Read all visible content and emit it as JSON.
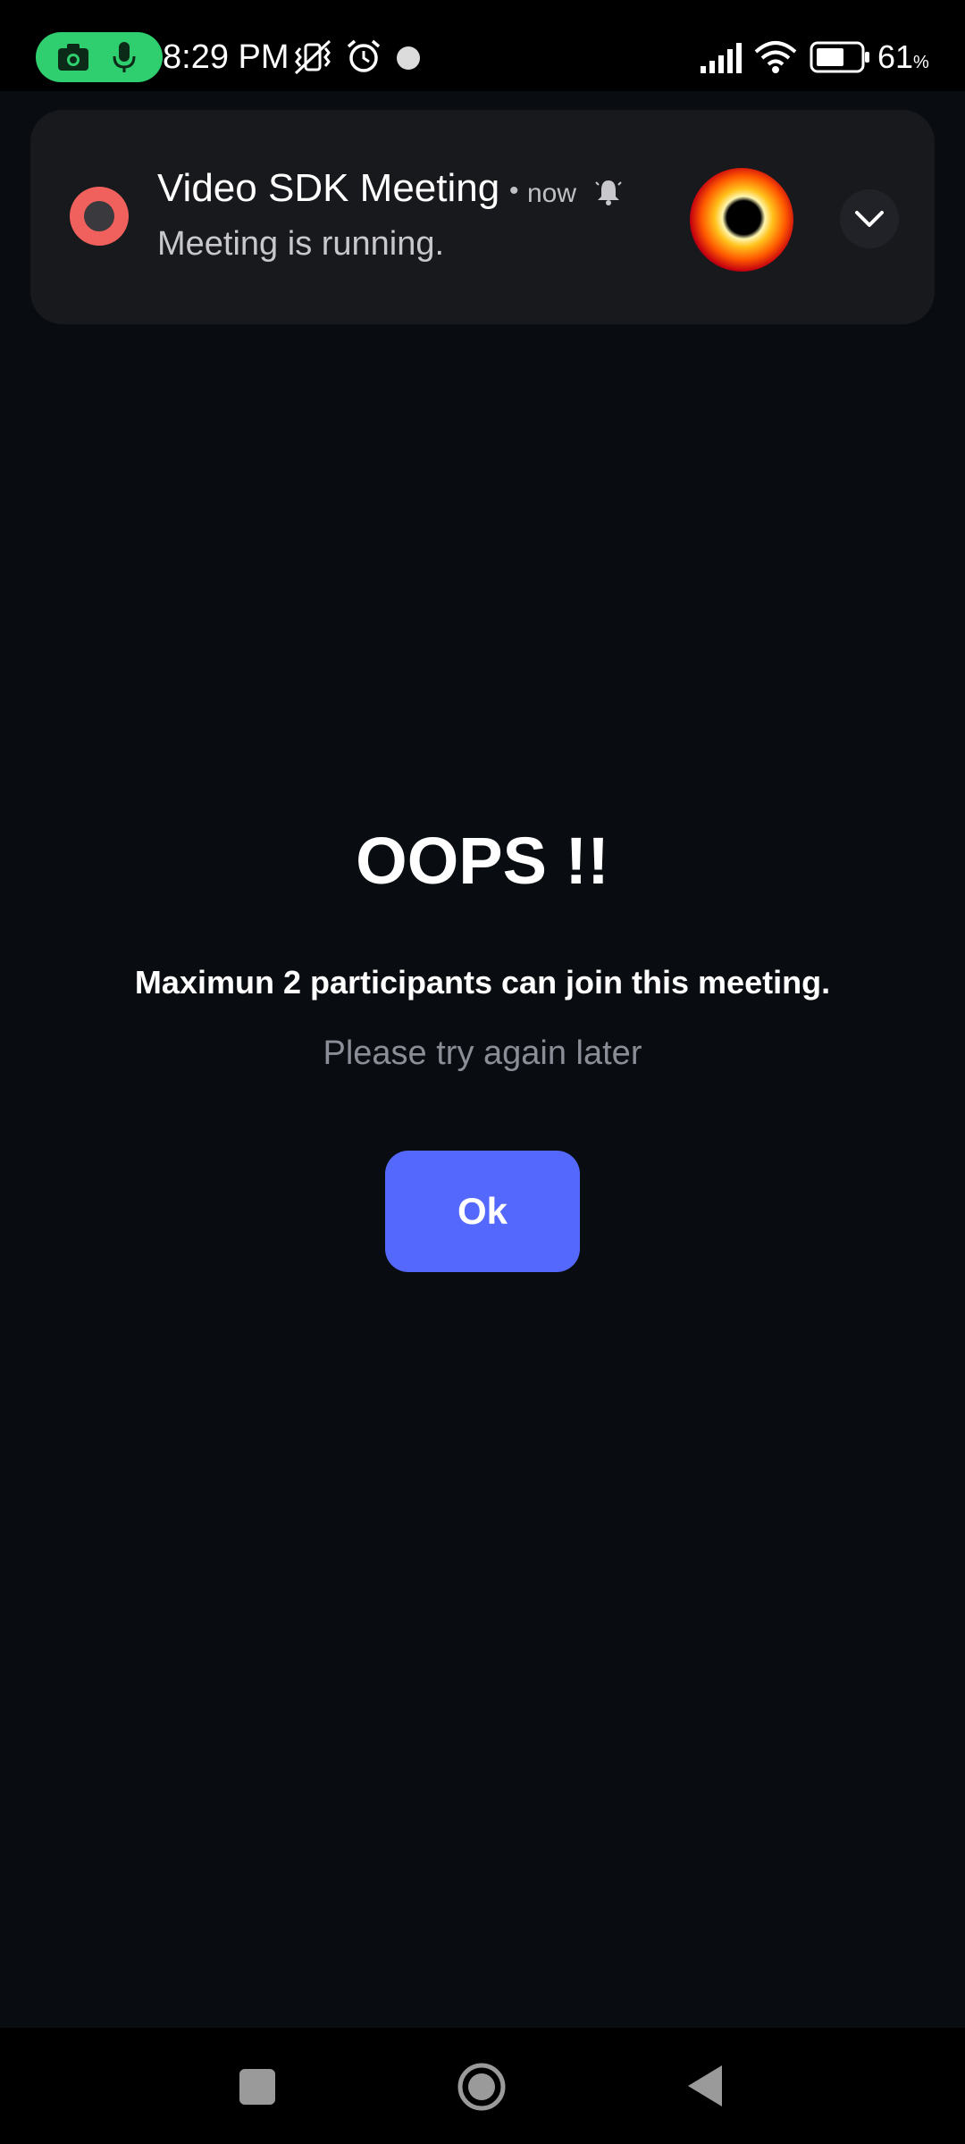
{
  "status_bar": {
    "time": "8:29 PM",
    "battery_percent": "61",
    "battery_unit": "%",
    "pill_color": "#2fcf6f",
    "icons": [
      "camera-icon",
      "microphone-icon",
      "vibrate-off-icon",
      "alarm-icon",
      "notification-dot-icon",
      "signal-icon",
      "wifi-icon",
      "battery-icon"
    ]
  },
  "notification": {
    "app_name": "Video SDK Meeting",
    "separator": "•",
    "time": "now",
    "text": "Meeting is running.",
    "icons": [
      "record-icon",
      "bell-icon",
      "thumbnail-image",
      "chevron-down-icon"
    ]
  },
  "dialog": {
    "title": "OOPS !!",
    "message": "Maximun 2 participants can join this meeting.",
    "subtext": "Please try again later",
    "ok_label": "Ok",
    "accent_color": "#5568fe"
  },
  "nav_bar": {
    "icons": [
      "recents-icon",
      "home-icon",
      "back-icon"
    ]
  }
}
